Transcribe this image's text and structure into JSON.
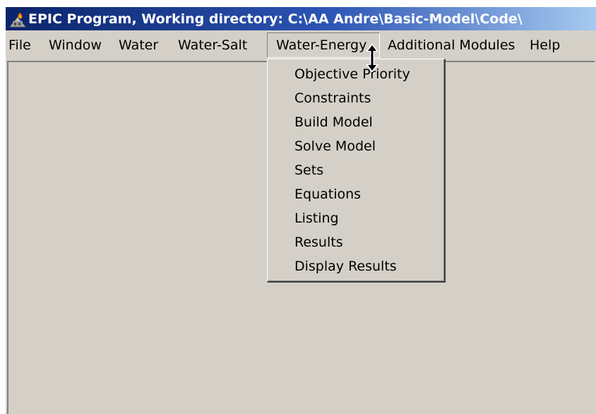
{
  "window": {
    "title": "EPIC Program,  Working directory: C:\\AA Andre\\Basic-Model\\Code\\",
    "app_icon": "epic-app-icon"
  },
  "menubar": {
    "items": [
      {
        "label": "File"
      },
      {
        "label": "Window"
      },
      {
        "label": "Water"
      },
      {
        "label": "Water-Salt"
      },
      {
        "label": "Water-Energy",
        "active": true
      },
      {
        "label": "Additional Modules"
      },
      {
        "label": "Help"
      }
    ]
  },
  "dropdown": {
    "parent": "Water-Energy",
    "items": [
      {
        "label": "Objective Priority"
      },
      {
        "label": "Constraints"
      },
      {
        "label": "Build Model"
      },
      {
        "label": "Solve Model"
      },
      {
        "label": "Sets"
      },
      {
        "label": "Equations"
      },
      {
        "label": "Listing"
      },
      {
        "label": "Results"
      },
      {
        "label": "Display Results"
      }
    ]
  },
  "cursor": {
    "icon": "resize-vertical-cursor-icon"
  },
  "colors": {
    "title_bar_start": "#0a246a",
    "title_bar_end": "#a6caf0",
    "face": "#d4d0c8"
  }
}
